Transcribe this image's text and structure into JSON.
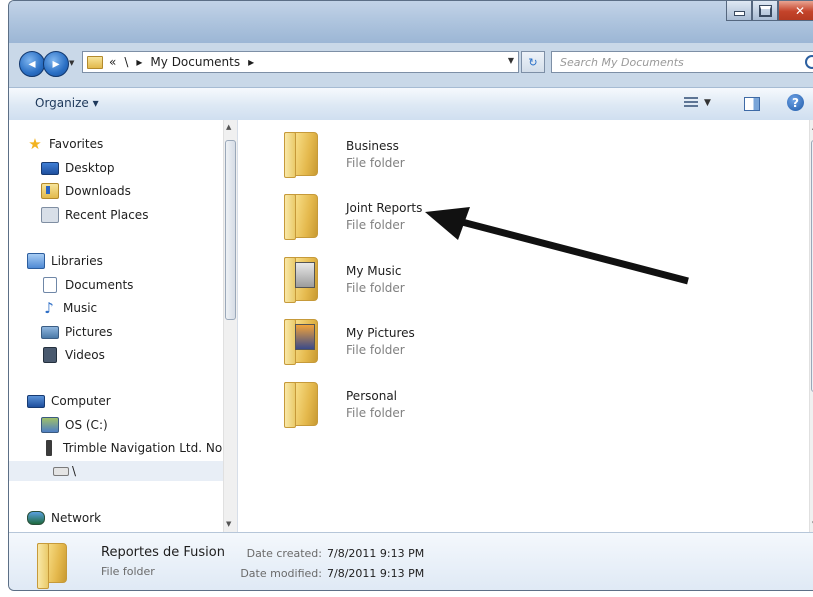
{
  "address": {
    "crumbs": [
      "«",
      "\\",
      "▸",
      "My Documents",
      "▸"
    ]
  },
  "search": {
    "placeholder": "Search My Documents"
  },
  "toolbar": {
    "organize_label": "Organize ▾"
  },
  "nav": {
    "favorites": "Favorites",
    "desktop": "Desktop",
    "downloads": "Downloads",
    "recent": "Recent Places",
    "libraries": "Libraries",
    "documents": "Documents",
    "music": "Music",
    "pictures": "Pictures",
    "videos": "Videos",
    "computer": "Computer",
    "os": "OS (C:)",
    "trimble": "Trimble Navigation Ltd. Nor",
    "drive_root": "\\",
    "network": "Network"
  },
  "folders": [
    {
      "name": "Business",
      "type": "File folder"
    },
    {
      "name": "Joint Reports",
      "type": "File folder"
    },
    {
      "name": "My Music",
      "type": "File folder"
    },
    {
      "name": "My Pictures",
      "type": "File folder"
    },
    {
      "name": "Personal",
      "type": "File folder"
    }
  ],
  "details": {
    "name": "Reportes de Fusion",
    "type": "File folder",
    "created_label": "Date created:",
    "created_value": "7/8/2011 9:13 PM",
    "modified_label": "Date modified:",
    "modified_value": "7/8/2011 9:13 PM"
  }
}
